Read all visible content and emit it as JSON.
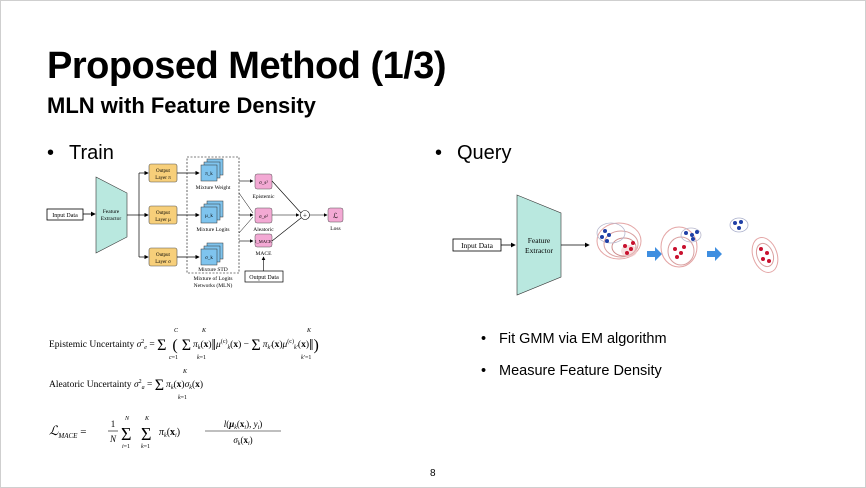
{
  "slide": {
    "title": "Proposed Method (1/3)",
    "subtitle": "MLN with Feature Density",
    "page_number": "8"
  },
  "train": {
    "heading": "Train",
    "input": "Input Data",
    "extractor": [
      "Feature",
      "Extractor"
    ],
    "output_layers": [
      [
        "Output",
        "Layer π"
      ],
      [
        "Output",
        "Layer μ"
      ],
      [
        "Output",
        "Layer σ"
      ]
    ],
    "mixture_labels": [
      "Mixture Weight",
      "Mixture Logits",
      "Mixture STD"
    ],
    "mixture_symbols": [
      "π_k",
      "μ_k",
      "σ_k"
    ],
    "mln_caption": [
      "Mixture of Logits",
      "Networks (MLN)"
    ],
    "uncertainty_labels": [
      "Epistemic",
      "Aleatoric",
      "MACE"
    ],
    "uncertainty_symbols": [
      "σ_s²",
      "σ_e²",
      "l_MACE"
    ],
    "plus": "+",
    "loss_symbol": "ℒ",
    "loss_label": "Loss",
    "output_data": "Output Data"
  },
  "query": {
    "heading": "Query",
    "input": "Input Data",
    "extractor": [
      "Feature",
      "Extractor"
    ]
  },
  "steps": [
    "Fit GMM via EM algorithm",
    "Measure Feature Density"
  ],
  "equations": {
    "epistemic": "Epistemic Uncertainty σ_e² = Σ_{c=1}^{C} ( Σ_{k=1}^{K} π_k(x) ‖ μ_k^(c)(x) − Σ_{k'=1}^{K} π_{k'}(x) μ_{k'}^(c)(x) ‖ )",
    "aleatoric": "Aleatoric Uncertainty σ_a² = Σ_{k=1}^{K} π_k(x) σ_k(x)",
    "mace": "ℒ_MACE = (1/N) Σ_{i=1}^{N} Σ_{k=1}^{K} π_k(x_i) l(μ_k(x_i), y_i) / σ_k(x_i)"
  },
  "colors": {
    "extractor_fill": "#b9e8df",
    "output_layer_fill": "#f7cf7a",
    "mixture_fill": "#7fc4ee",
    "uncertainty_fill": "#f3a9d4",
    "cluster_red": "#c8102e",
    "cluster_blue": "#1f3fa6",
    "arrow_blue": "#3e8ee0"
  }
}
